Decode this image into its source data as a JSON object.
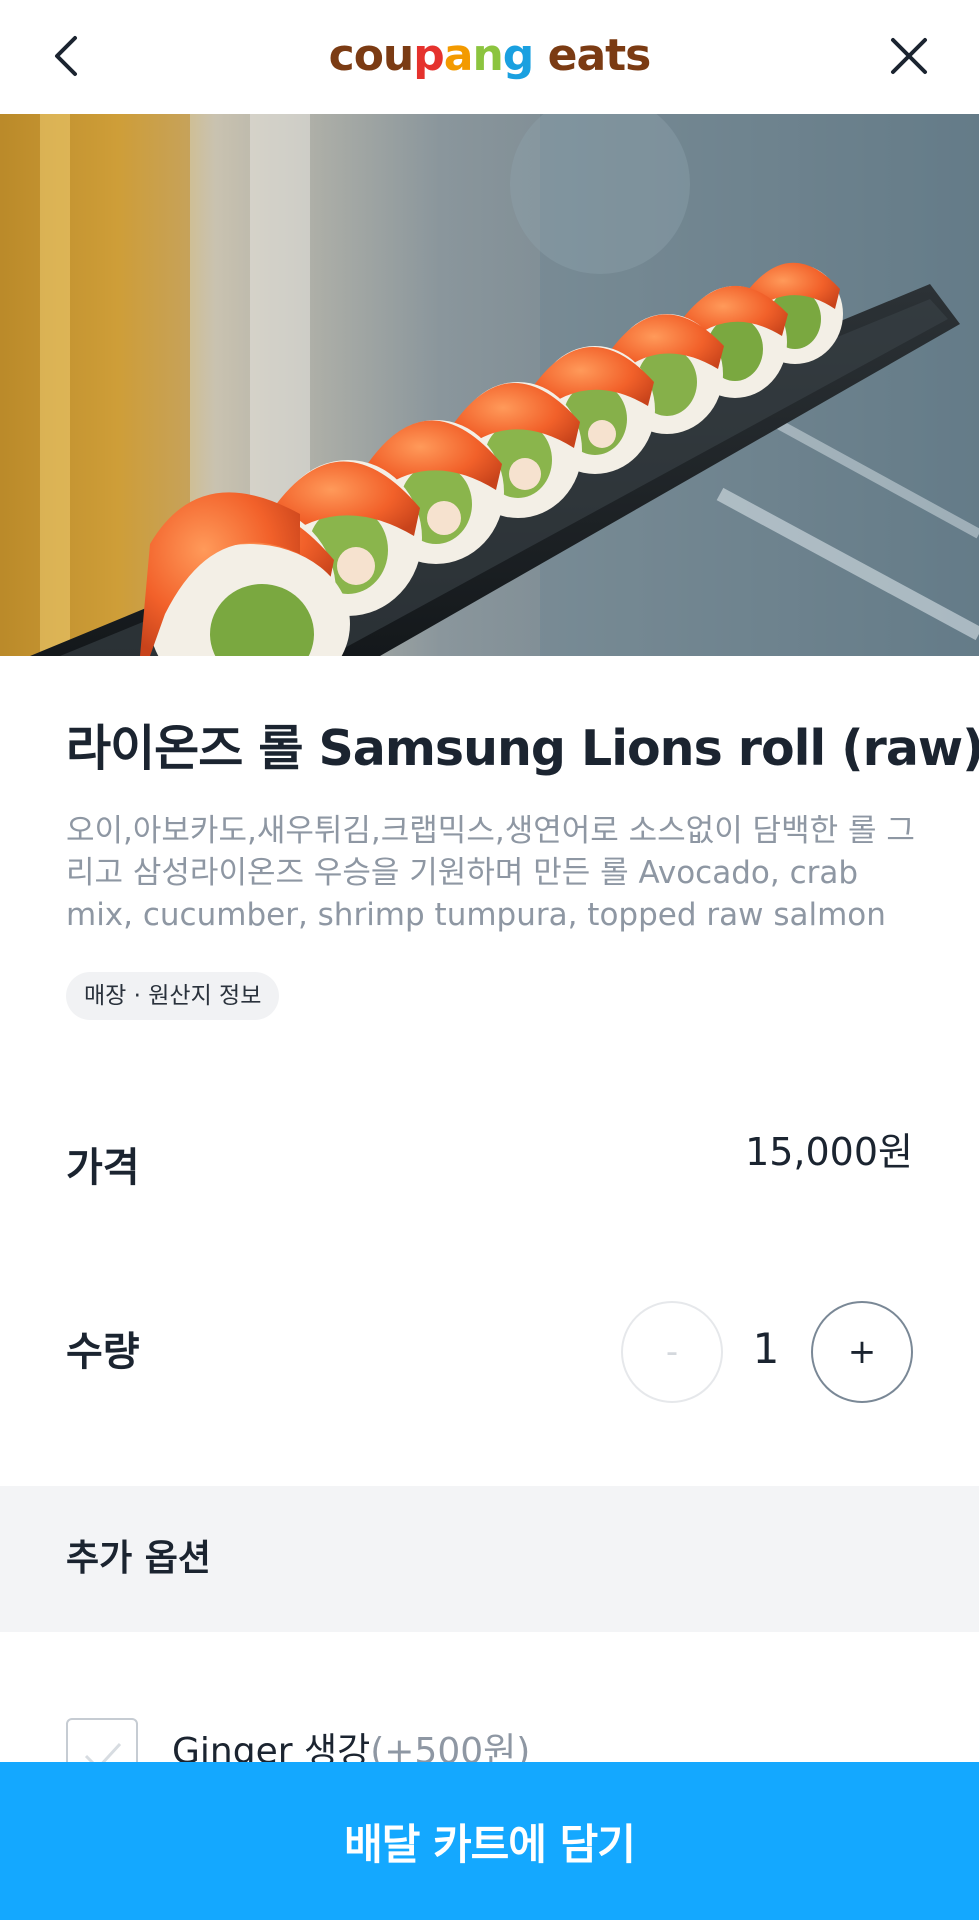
{
  "header": {
    "logo_parts": [
      "cou",
      "p",
      "a",
      "n",
      "g",
      " eats"
    ],
    "logo_colors": {
      "brown": "#7b3b13",
      "red": "#e5322d",
      "orange": "#f39a00",
      "yellow_green": "#8cc43f",
      "blue": "#1aa0e0"
    },
    "back_icon": "chevron-left-icon",
    "close_icon": "close-icon"
  },
  "item": {
    "title": "라이온즈 롤 Samsung Lions roll (raw)",
    "description": "오이,아보카도,새우튀김,크랩믹스,생연어로 소스없이 담백한 롤 그리고 삼성라이온즈 우승을 기원하며 만든 롤 Avocado, crab mix, cucumber, shrimp tumpura, topped raw salmon",
    "info_chip": "매장 · 원산지 정보"
  },
  "price": {
    "label": "가격",
    "value": "15,000원"
  },
  "quantity": {
    "label": "수량",
    "value": "1",
    "minus": "-",
    "plus": "+"
  },
  "options": {
    "title": "추가 옵션",
    "items": [
      {
        "label": "Ginger 생강",
        "price": "(+500원)",
        "checked": false
      }
    ]
  },
  "cta": {
    "label": "배달 카트에 담기",
    "color": "#14a8ff"
  }
}
